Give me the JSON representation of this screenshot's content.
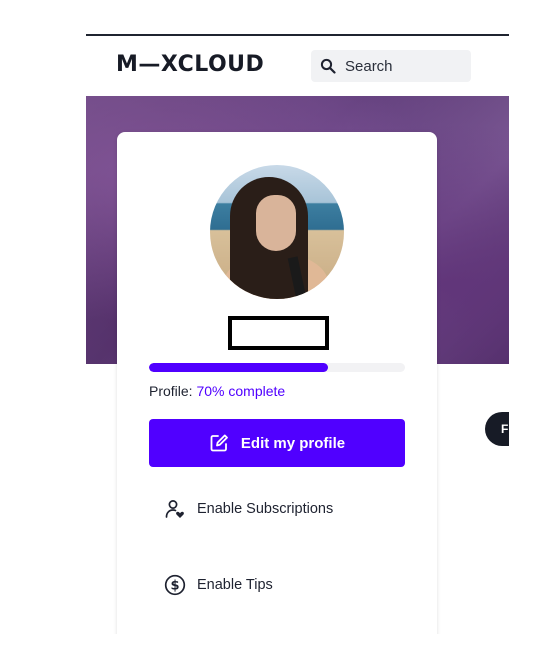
{
  "header": {
    "logo_text": "M—XCLOUD",
    "search_label": "Search"
  },
  "follow_button": {
    "label": "F"
  },
  "profile_card": {
    "progress": {
      "percent_complete": 70,
      "status_prefix": "Profile: ",
      "status_value": "70% complete"
    },
    "edit_button_label": "Edit my profile",
    "menu": [
      {
        "label": "Enable Subscriptions",
        "icon": "person-heart-icon"
      },
      {
        "label": "Enable Tips",
        "icon": "dollar-circle-icon"
      }
    ]
  },
  "colors": {
    "accent": "#5000ff",
    "dark": "#171b26",
    "track": "#f2f2f4"
  }
}
